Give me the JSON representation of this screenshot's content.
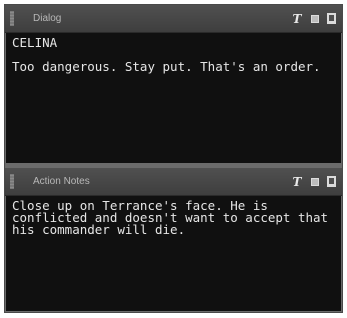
{
  "dialog_panel": {
    "title": "Dialog",
    "speaker": "CELINA",
    "text": "Too dangerous. Stay put. That's an order.",
    "icons": [
      "text-format-icon",
      "square-icon",
      "bookmark-icon"
    ]
  },
  "notes_panel": {
    "title": "Action Notes",
    "text": "Close up on Terrance's face. He is conflicted and doesn't want to accept that his commander will die.",
    "icons": [
      "text-format-icon",
      "square-icon",
      "bookmark-icon"
    ]
  },
  "toolbar": {
    "format_glyph": "T"
  }
}
